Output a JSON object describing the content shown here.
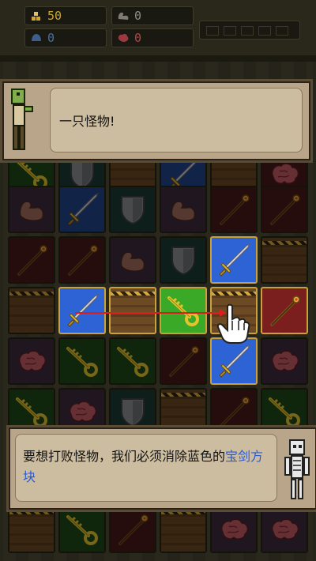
{
  "hud": {
    "gold": "50",
    "strength": "0",
    "defense": "0",
    "brain": "0"
  },
  "colors": {
    "sword_tile": "#2e63d6",
    "key_tile": "#3aa928",
    "staff_tile": "#7a1e1e",
    "dialog_bg": "#b9a68a",
    "highlight_text": "#2a5bd1",
    "swipe_arrow": "#e01b1b"
  },
  "tutorial": {
    "top_message": "一只怪物!",
    "bottom_message_prefix": "要想打败怪物，我们必须消除蓝色的",
    "bottom_message_highlight": "宝剑方块"
  },
  "board": {
    "visible_rows": [
      [
        "key",
        "shield",
        "crate",
        "sword",
        "crate",
        "brain"
      ],
      [
        "strength",
        "sword",
        "shield",
        "strength",
        "staff",
        "staff"
      ],
      [
        "staff",
        "staff",
        "strength",
        "shield",
        "sword",
        "crate"
      ],
      [
        "crate",
        "sword",
        "crate",
        "key",
        "crate",
        "staff"
      ],
      [
        "brain",
        "key",
        "key",
        "staff",
        "sword",
        "brain"
      ],
      [
        "key",
        "brain",
        "shield",
        "crate",
        "staff",
        "key"
      ],
      [
        "crate",
        "key",
        "staff",
        "crate",
        "brain",
        "brain"
      ]
    ],
    "highlighted_tiles": [
      "sword",
      "crate",
      "key",
      "crate",
      "staff",
      "sword"
    ]
  },
  "icons": {
    "gold_icon": "gold-bars-icon",
    "strength_icon": "flexed-arm-icon",
    "defense_icon": "helmet-icon",
    "brain_icon": "brain-icon",
    "hand_icon": "pointing-hand-icon",
    "hero_icon": "zombie-hero-portrait",
    "skeleton_icon": "skeleton-portrait"
  }
}
